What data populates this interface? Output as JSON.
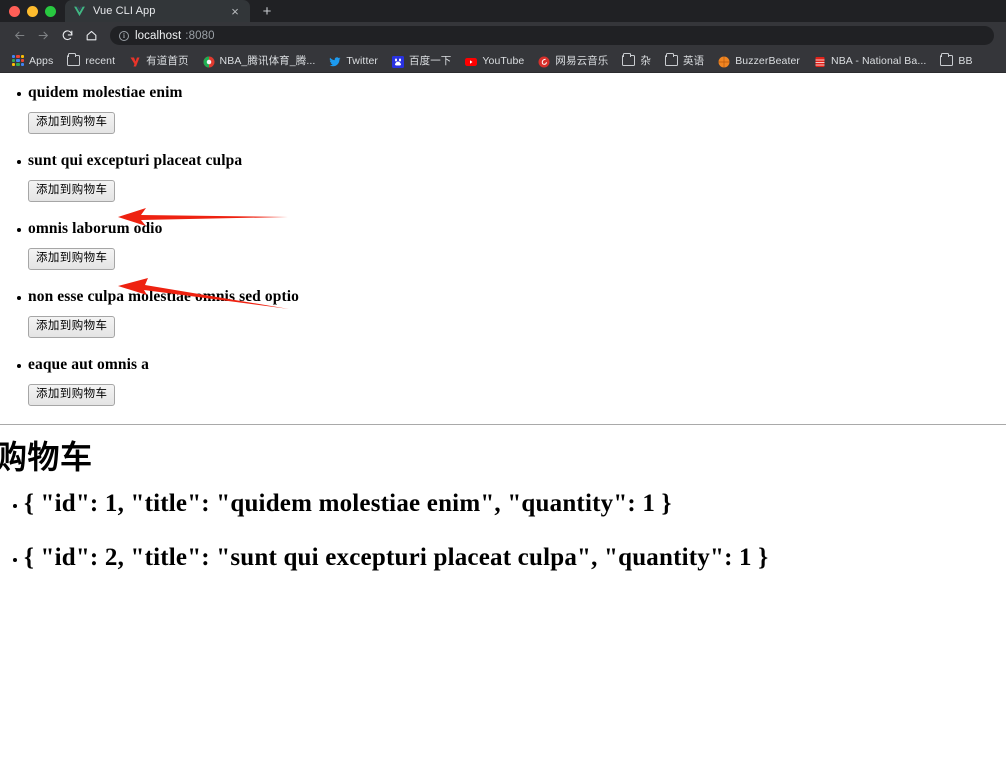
{
  "browser": {
    "window_controls": [
      "close",
      "minimize",
      "maximize"
    ],
    "tab": {
      "title": "Vue CLI App",
      "favicon": "vue-logo-icon",
      "close_label": "×"
    },
    "new_tab_label": "+",
    "nav": {
      "back_icon": "back-arrow-icon",
      "forward_icon": "forward-arrow-icon",
      "reload_icon": "reload-icon",
      "home_icon": "home-icon"
    },
    "address_bar": {
      "info_icon": "ⓘ",
      "host": "localhost",
      "port": ":8080"
    },
    "bookmarks": [
      {
        "label": "Apps",
        "icon": "apps-grid-icon"
      },
      {
        "label": "recent",
        "icon": "folder-icon"
      },
      {
        "label": "有道首页",
        "icon": "youdao-icon"
      },
      {
        "label": "NBA_腾讯体育_腾...",
        "icon": "tencent-sports-icon"
      },
      {
        "label": "Twitter",
        "icon": "twitter-bird-icon"
      },
      {
        "label": "百度一下",
        "icon": "baidu-icon"
      },
      {
        "label": "YouTube",
        "icon": "youtube-icon"
      },
      {
        "label": "网易云音乐",
        "icon": "netease-music-icon"
      },
      {
        "label": "杂",
        "icon": "folder-icon"
      },
      {
        "label": "英语",
        "icon": "folder-icon"
      },
      {
        "label": "BuzzerBeater",
        "icon": "basketball-icon"
      },
      {
        "label": "NBA - National Ba...",
        "icon": "nba-icon"
      },
      {
        "label": "BB",
        "icon": "folder-icon"
      }
    ]
  },
  "page": {
    "products": [
      {
        "title": "quidem molestiae enim",
        "button": "添加到购物车"
      },
      {
        "title": "sunt qui excepturi placeat culpa",
        "button": "添加到购物车"
      },
      {
        "title": "omnis laborum odio",
        "button": "添加到购物车"
      },
      {
        "title": "non esse culpa molestiae omnis sed optio",
        "button": "添加到购物车"
      },
      {
        "title": "eaque aut omnis a",
        "button": "添加到购物车"
      }
    ],
    "cart": {
      "heading": "购物车",
      "items": [
        "{ \"id\": 1, \"title\": \"quidem molestiae enim\", \"quantity\": 1 }",
        "{ \"id\": 2, \"title\": \"sunt qui excepturi placeat culpa\", \"quantity\": 1 }"
      ]
    }
  },
  "annotations": {
    "arrow_color": "#ee2211",
    "arrows": [
      {
        "name": "arrow-to-add-button-1",
        "points_to": "add-to-cart-button-1"
      },
      {
        "name": "arrow-to-add-button-2",
        "points_to": "add-to-cart-button-2"
      }
    ]
  },
  "colors": {
    "chrome_tabstrip": "#202124",
    "chrome_toolbar": "#35363a",
    "page_background": "#ffffff",
    "text": "#000000",
    "accent_red": "#ee2211"
  }
}
